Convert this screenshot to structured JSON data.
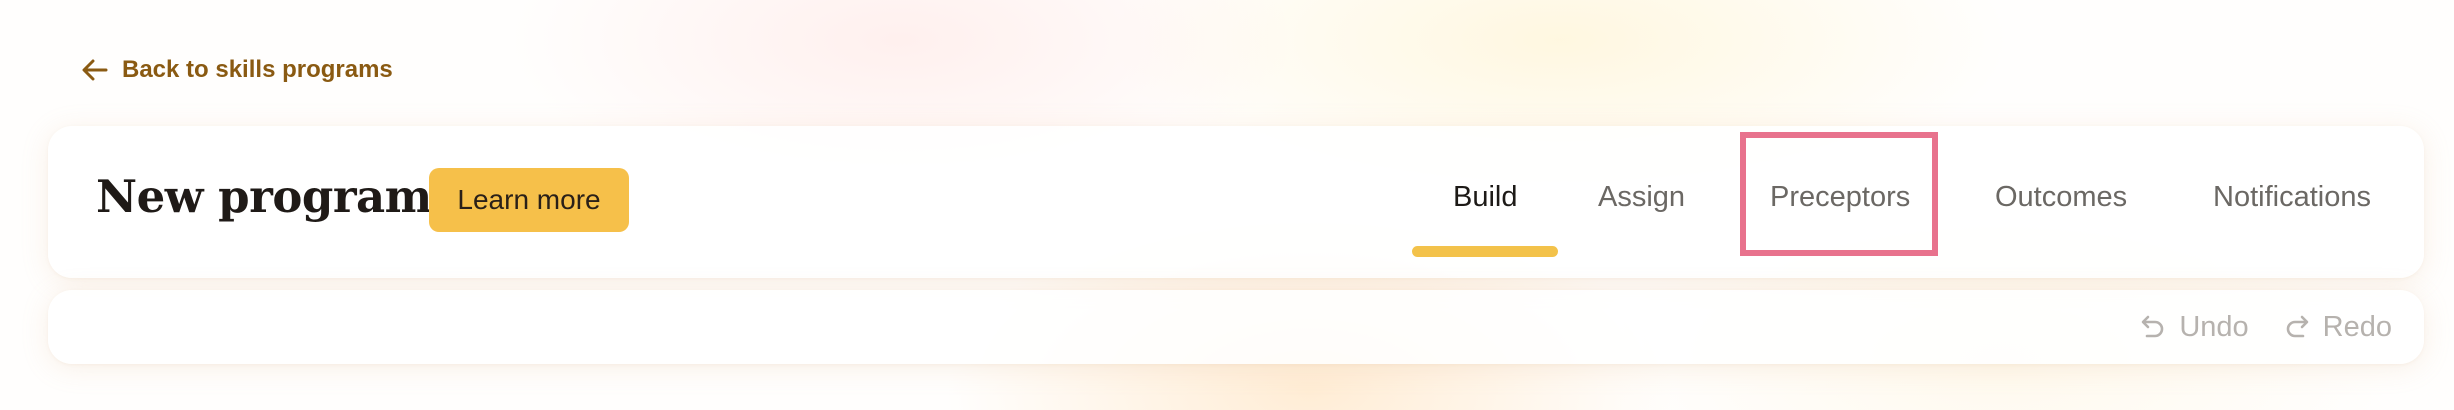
{
  "back_link": {
    "label": "Back to skills programs",
    "icon": "arrow-left-icon"
  },
  "header": {
    "title": "New program",
    "learn_more_label": "Learn more",
    "tabs": [
      {
        "label": "Build",
        "active": true
      },
      {
        "label": "Assign",
        "active": false
      },
      {
        "label": "Preceptors",
        "active": false,
        "highlighted": true
      },
      {
        "label": "Outcomes",
        "active": false
      },
      {
        "label": "Notifications",
        "active": false
      }
    ]
  },
  "toolbar": {
    "undo_label": "Undo",
    "undo_icon": "undo-icon",
    "redo_label": "Redo",
    "redo_icon": "redo-icon"
  },
  "colors": {
    "accent": "#f6c04a",
    "back_link": "#8a5a12",
    "highlight": "#e8728d",
    "tab_inactive": "#6b6864",
    "disabled": "#b6b2ae"
  }
}
